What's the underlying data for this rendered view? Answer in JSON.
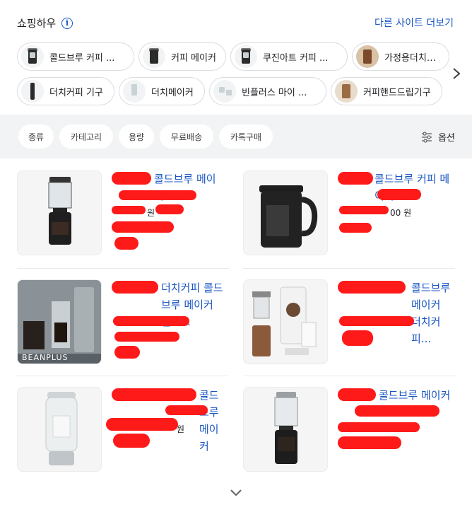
{
  "header": {
    "title": "쇼핑하우",
    "info_icon": "info-icon",
    "more_link": "다른 사이트 더보기"
  },
  "chips": [
    {
      "label": "콜드브루 커피 ..."
    },
    {
      "label": "커피 메이커"
    },
    {
      "label": "쿠진아트 커피 ..."
    },
    {
      "label": "가정용더치커피"
    },
    {
      "label": "더치커피 기구"
    },
    {
      "label": "더치메이커"
    },
    {
      "label": "빈플러스 마이 ..."
    },
    {
      "label": "커피핸드드립기구"
    }
  ],
  "filters": {
    "chips": [
      "종류",
      "카테고리",
      "용량",
      "무료배송",
      "카톡구매"
    ],
    "options_label": "옵션"
  },
  "products": [
    {
      "title": "콜드브루 메이커",
      "price": "원",
      "seller": ""
    },
    {
      "title": "콜드브루 커피 메이커",
      "price": "00 원",
      "seller": ""
    },
    {
      "title": "더치커피 콜드브루 메이커 핸드...",
      "price": "",
      "seller": "",
      "image_text": "BEANPLUS"
    },
    {
      "title": "콜드브루메이커 더치커피...",
      "price": "",
      "seller": ""
    },
    {
      "title": "콜드브루메이커",
      "price": "원",
      "seller": ""
    },
    {
      "title": "콜드브루 메이커",
      "price": "",
      "seller": ""
    }
  ],
  "colors": {
    "link": "#1a56c4",
    "filter_bg": "#f1f3f4",
    "redaction": "#ff1a1a"
  }
}
